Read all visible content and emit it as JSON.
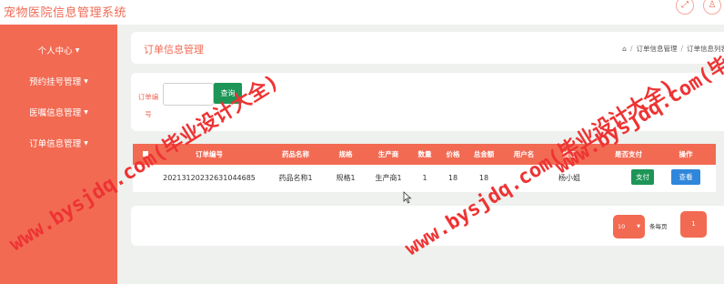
{
  "app": {
    "title": "宠物医院信息管理系统"
  },
  "top_icons": [
    {
      "name": "fullscreen-icon",
      "glyph": "⤢"
    },
    {
      "name": "user-icon",
      "glyph": "♙"
    }
  ],
  "sidebar": {
    "items": [
      {
        "label": "个人中心"
      },
      {
        "label": "预约挂号管理"
      },
      {
        "label": "医嘱信息管理"
      },
      {
        "label": "订单信息管理"
      }
    ]
  },
  "header": {
    "title": "订单信息管理",
    "breadcrumb": [
      "订单信息管理",
      "订单信息列表"
    ],
    "home_icon": "home-icon"
  },
  "search": {
    "label": "订单编号",
    "value": "",
    "button": "查询"
  },
  "table": {
    "columns": [
      "订单编号",
      "药品名称",
      "规格",
      "生产商",
      "数量",
      "价格",
      "总金额",
      "用户名",
      "姓名",
      "是否支付",
      "操作"
    ],
    "rows": [
      {
        "order_no": "20213120232631044685",
        "drug_name": "药品名称1",
        "spec": "规格1",
        "maker": "生产商1",
        "qty": "1",
        "price": "18",
        "total": "18",
        "username": "",
        "name": "杨小姐",
        "paid_label": "支付",
        "action_label": "查看"
      }
    ]
  },
  "pagination": {
    "page_size": "10",
    "per_page_label": "条每页",
    "current_page": "1"
  },
  "watermarks": [
    "www.bysjdq.com(毕业设计大全)",
    "www.bysjdq.com(毕业设计大全)",
    "www.bysjdq.com(毕业设计大全)"
  ],
  "colors": {
    "accent": "#f26a52",
    "success": "#1c9556",
    "primary": "#2f86db",
    "watermark": "#e33333"
  }
}
